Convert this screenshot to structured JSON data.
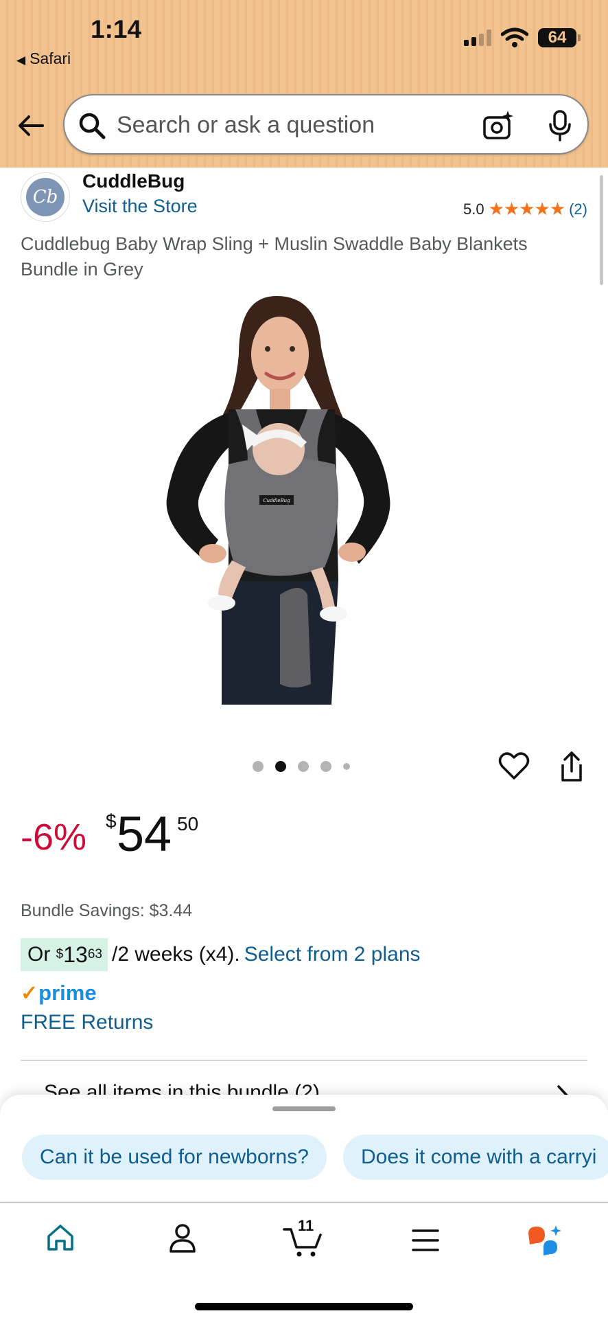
{
  "status_bar": {
    "time": "1:14",
    "back_app": "Safari",
    "battery": "64"
  },
  "search": {
    "placeholder": "Search or ask a question",
    "icons": [
      "back-arrow-icon",
      "search-icon",
      "camera-sparkle-icon",
      "microphone-icon"
    ]
  },
  "store": {
    "logo_text": "Cb",
    "brand": "CuddleBug",
    "visit_label": "Visit the Store",
    "rating_value": "5.0",
    "stars": "★★★★★",
    "rating_count": "(2)"
  },
  "product": {
    "title": "Cuddlebug Baby Wrap Sling + Muslin Swaddle Baby Blankets Bundle in Grey",
    "image_label": "CuddleBug",
    "carousel_active_index": 1,
    "carousel_count": 5
  },
  "price": {
    "discount": "-6%",
    "currency": "$",
    "whole": "54",
    "fraction": "50"
  },
  "bundle_savings": "Bundle Savings: $3.44",
  "installments": {
    "or": "Or",
    "currency": "$",
    "whole": "13",
    "fraction": "63",
    "per": "/2 weeks (x4).",
    "link": "Select from 2 plans"
  },
  "prime": {
    "check": "✓",
    "label": "prime",
    "returns": "FREE Returns"
  },
  "bundle_items_label": "See all items in this bundle (2)",
  "suggestions": [
    "Can it be used for newborns?",
    "Does it come with a carryi"
  ],
  "tabbar": {
    "items": [
      "home-icon",
      "account-icon",
      "cart-icon",
      "menu-icon",
      "rufus-icon"
    ],
    "cart_count": "11"
  },
  "colors": {
    "header_bg": "#f2c28f",
    "link": "#0f5e8f",
    "discount": "#cc0c39",
    "star": "#f5721d",
    "prime_blue": "#1a8de0",
    "prime_check": "#f08804",
    "chip_bg": "#dff1fb",
    "installment_bg": "#d6f2e6"
  }
}
